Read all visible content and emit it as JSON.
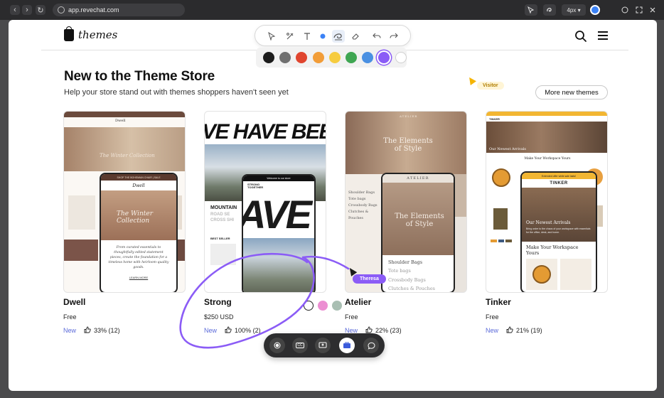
{
  "browser": {
    "url": "app.revechat.com",
    "stroke_size": "4px",
    "stroke_caret": "▾"
  },
  "header": {
    "brand": "themes"
  },
  "annotation": {
    "tools": [
      "select-arrow",
      "laser-pointer",
      "text",
      "dot",
      "freehand",
      "eraser",
      "undo",
      "redo"
    ],
    "palette": [
      "#1c1c1c",
      "#707070",
      "#e0452f",
      "#f29d38",
      "#f6cc3f",
      "#3fa652",
      "#4a90e2",
      "#8b5cf6",
      "#ffffff"
    ],
    "selected_color": "#8b5cf6"
  },
  "section": {
    "title": "New to the Theme Store",
    "subtitle": "Help your store stand out with themes shoppers haven't seen yet",
    "more_button": "More new themes"
  },
  "visitor_label": "Visitor",
  "presenter_label": "Theresa",
  "cards": [
    {
      "name": "Dwell",
      "price": "Free",
      "badge": "New",
      "rating": "33% (12)",
      "mock": {
        "store_name": "Dwell",
        "banner": "The Winter Collection",
        "phone_title": "The Winter Collection",
        "copy": "From curated essentials to thoughtfully edited statement pieces, create the foundation for a timeless home with heirloom-quality goods.",
        "link": "LEARN MORE",
        "promo": "SHOP THE BOHEMIAN CHAIR  |  SALE"
      }
    },
    {
      "name": "Strong",
      "price": "$250 USD",
      "badge": "New",
      "rating": "100% (2)",
      "mock": {
        "hero": "VE HAVE BEE",
        "phone_hero": "AVE I",
        "heading": "MOUNTAIN",
        "sub": "ROAD SE\nCROSS SHI",
        "best": "BEST SELLER",
        "welcome": "Welcome to our store",
        "logo": "STRONG TOGETHER"
      },
      "swatches": [
        "#ffffff",
        "#ec8fd2",
        "#a9bfb3"
      ]
    },
    {
      "name": "Atelier",
      "price": "Free",
      "badge": "New",
      "rating": "22% (23)",
      "mock": {
        "brand": "ATELIER",
        "hero": "The Elements of Style",
        "phone_brand": "ATELIER",
        "phone_hero": "The Elements of Style",
        "cats": [
          "Shoulder Bags",
          "Tote bags",
          "Crossbody Bags",
          "Clutches & Pouches"
        ]
      }
    },
    {
      "name": "Tinker",
      "price": "Free",
      "badge": "New",
      "rating": "21% (19)",
      "mock": {
        "brand": "TINKER",
        "arrivals": "Our Newest Arrivals",
        "workspace": "Make Your Workspace Yours",
        "promo": "Extended offer while sale lasts!",
        "blurb": "Bring order to the chaos of your workspace with essentials for the office, desk, and home."
      }
    }
  ],
  "dock": {
    "buttons": [
      "record",
      "cc",
      "share-screen",
      "annotate",
      "chat"
    ],
    "cc_label": "CC",
    "active": "annotate"
  }
}
